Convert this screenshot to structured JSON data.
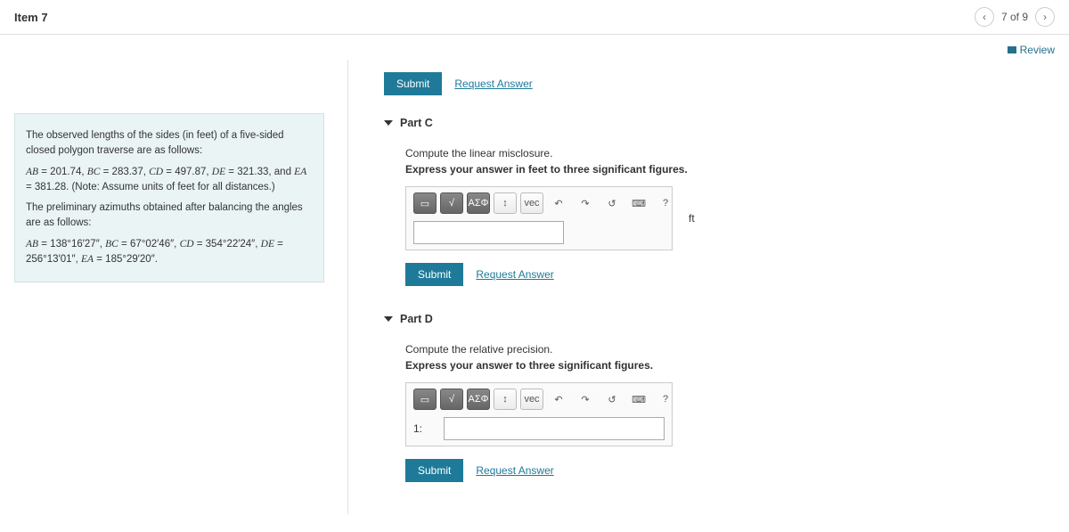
{
  "header": {
    "item_title": "Item 7",
    "page_indicator": "7 of 9",
    "review_label": "Review"
  },
  "problem": {
    "p1": "The observed lengths of the sides (in feet) of a five-sided closed polygon traverse are as follows:",
    "lengths_html": "<span class='math-i'>AB</span> = 201.74, <span class='math-i'>BC</span> = 283.37, <span class='math-i'>CD</span> = 497.87, <span class='math-i'>DE</span> = 321.33, and <span class='math-i'>EA</span> = 381.28. (Note: Assume units of feet for all distances.)",
    "p2": "The preliminary azimuths obtained after balancing the angles are as follows:",
    "azimuths_html": "<span class='math-i'>AB</span> = 138°16′27″, <span class='math-i'>BC</span> = 67°02′46″, <span class='math-i'>CD</span> = 354°22′24″, <span class='math-i'>DE</span> = 256°13′01″, <span class='math-i'>EA</span> = 185°29′20″."
  },
  "common": {
    "submit_label": "Submit",
    "request_answer_label": "Request Answer",
    "toolbar": {
      "templates": "▭",
      "root": "√",
      "greek": "ΑΣΦ",
      "scripts": "↕",
      "vec": "vec",
      "undo": "↶",
      "redo": "↷",
      "reset": "↺",
      "keyboard": "⌨",
      "help": "?"
    }
  },
  "partC": {
    "title": "Part C",
    "instr": "Compute the linear misclosure.",
    "instr_bold": "Express your answer in feet to three significant figures.",
    "unit": "ft"
  },
  "partD": {
    "title": "Part D",
    "instr": "Compute the relative precision.",
    "instr_bold": "Express your answer to three significant figures.",
    "prefix": "1:"
  }
}
